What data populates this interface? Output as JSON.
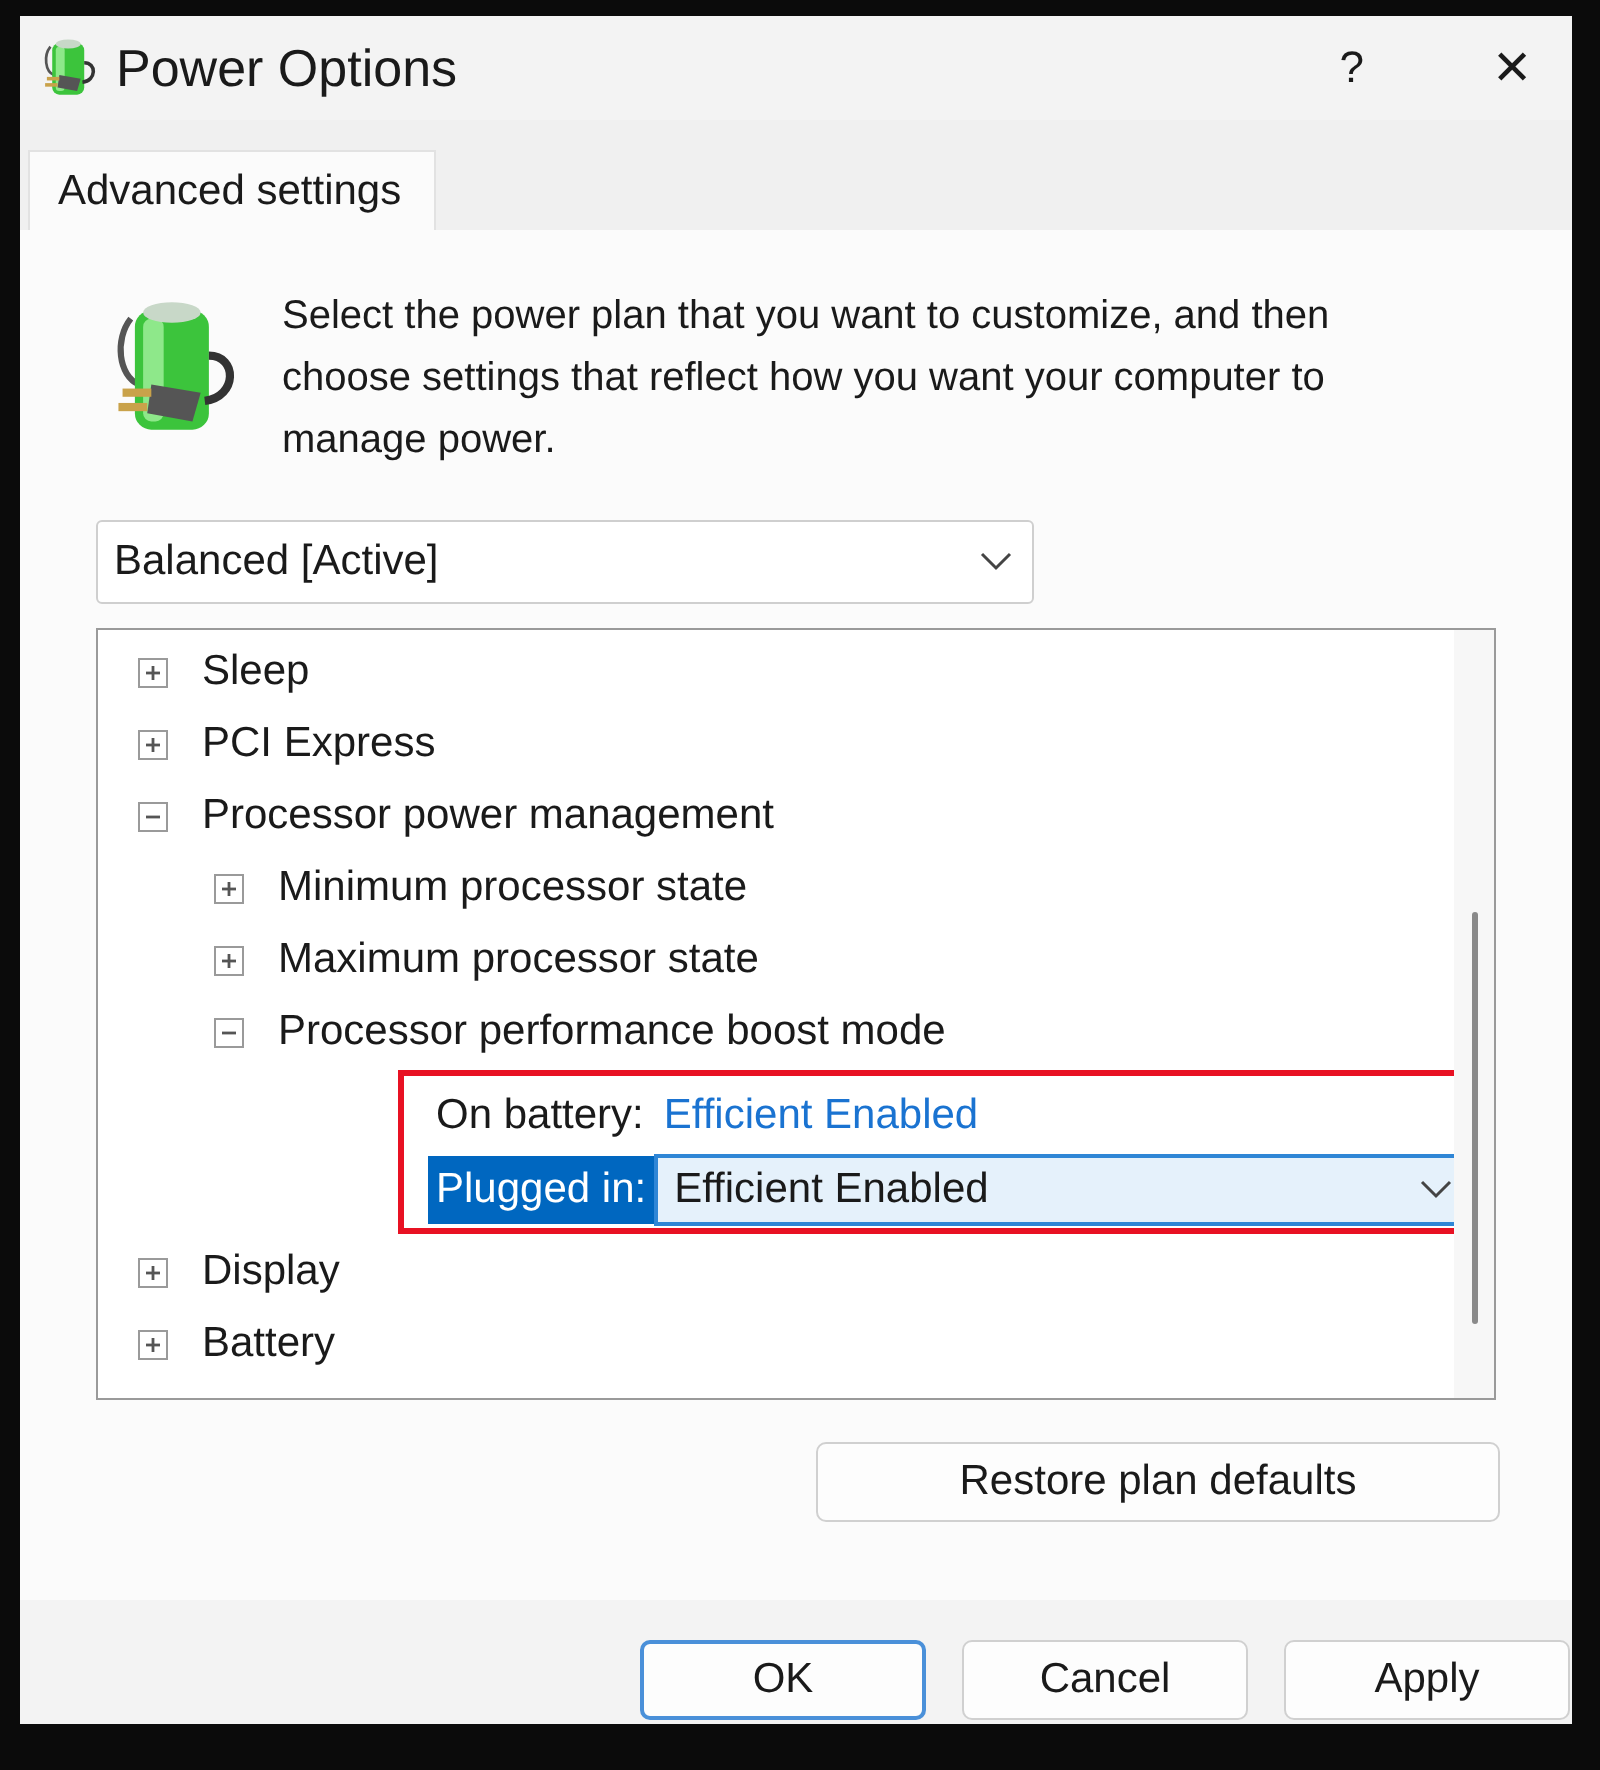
{
  "window": {
    "title": "Power Options",
    "help": "?",
    "close": "✕"
  },
  "tabs": [
    {
      "label": "Advanced settings",
      "selected": true
    }
  ],
  "description": "Select the power plan that you want to customize, and then choose settings that reflect how you want your computer to manage power.",
  "plan_dropdown": {
    "value": "Balanced [Active]"
  },
  "tree": [
    {
      "label": "Sleep",
      "expanded": false
    },
    {
      "label": "PCI Express",
      "expanded": false
    },
    {
      "label": "Processor power management",
      "expanded": true,
      "children": [
        {
          "label": "Minimum processor state",
          "expanded": false
        },
        {
          "label": "Maximum processor state",
          "expanded": false
        },
        {
          "label": "Processor performance boost mode",
          "expanded": true,
          "highlighted": true,
          "children": [
            {
              "kind": "setting",
              "label": "On battery:",
              "value": "Efficient Enabled",
              "selected": false
            },
            {
              "kind": "setting",
              "label": "Plugged in:",
              "value": "Efficient Enabled",
              "selected": true
            }
          ]
        }
      ]
    },
    {
      "label": "Display",
      "expanded": false
    },
    {
      "label": "Battery",
      "expanded": false
    }
  ],
  "restore_button": "Restore plan defaults",
  "buttons": [
    {
      "label": "OK",
      "default": true
    },
    {
      "label": "Cancel",
      "default": false
    },
    {
      "label": "Apply",
      "default": false
    }
  ]
}
